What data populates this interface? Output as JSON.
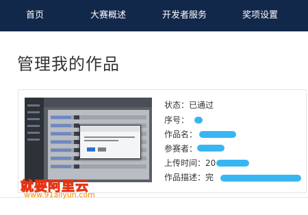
{
  "nav": {
    "items": [
      {
        "label": "首页"
      },
      {
        "label": "大赛概述"
      },
      {
        "label": "开发者服务"
      },
      {
        "label": "奖项设置"
      }
    ]
  },
  "page": {
    "title": "管理我的作品"
  },
  "work": {
    "status_label": "状态：",
    "status_value": "已通过",
    "serial_label": "序号：",
    "name_label": "作品名：",
    "participant_label": "参赛者：",
    "upload_label": "上传时间：",
    "upload_value_visible": "20",
    "desc_label": "作品描述：",
    "desc_value_visible": "完"
  },
  "watermark": {
    "site_name": "就要阿里云",
    "url": "www.91aliyun.com"
  },
  "colors": {
    "nav_bg": "#12284a",
    "redaction": "#38b6f2",
    "watermark_text": "#ffd000"
  }
}
